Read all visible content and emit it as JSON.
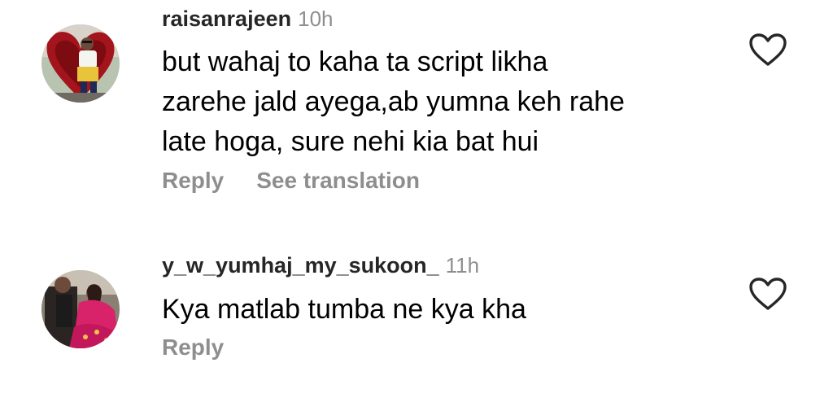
{
  "comments": [
    {
      "username": "raisanrajeen",
      "time": "10h",
      "lines": [
        "but wahaj to kaha ta script likha",
        "zarehe jald ayega,ab yumna keh rahe",
        "late hoga, sure nehi kia bat hui"
      ],
      "reply_label": "Reply",
      "translation_label": "See translation"
    },
    {
      "username": "y_w_yumhaj_my_sukoon_",
      "time": "11h",
      "lines": [
        "Kya matlab tumba ne kya kha"
      ],
      "reply_label": "Reply"
    }
  ],
  "icons": {
    "like": "heart-outline-icon"
  },
  "colors": {
    "username": "#262626",
    "secondary": "#8e8e8e",
    "text": "#000000"
  }
}
